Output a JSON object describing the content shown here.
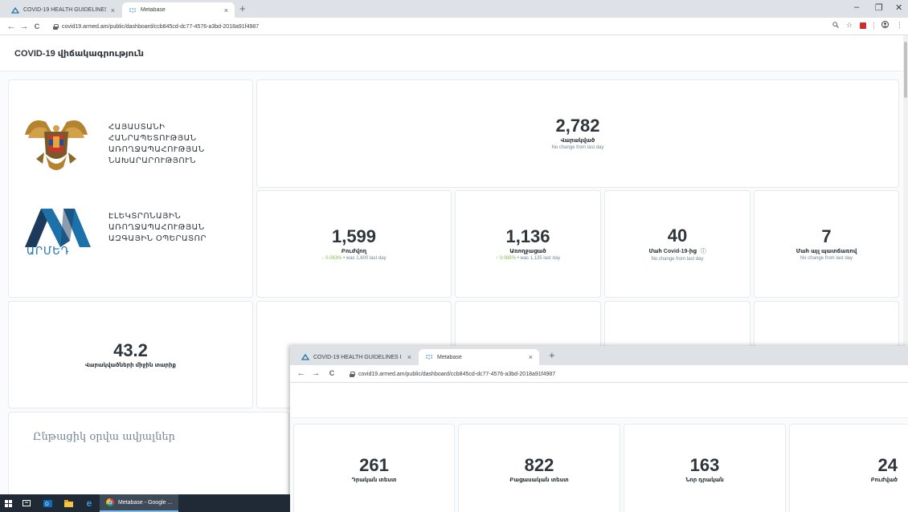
{
  "browser": {
    "tabs": [
      {
        "label": "COVID-19 HEALTH GUIDELINES I",
        "close": "×"
      },
      {
        "label": "Metabase",
        "close": "×"
      }
    ],
    "new_tab": "+",
    "window_controls": {
      "minimize": "–",
      "maximize": "❐",
      "close": "✕"
    },
    "nav": {
      "back": "←",
      "forward": "→",
      "reload": "C"
    },
    "url": "covid19.armed.am/public/dashboard/ccb845cd-dc77-4576-a3bd-2018a91f4987"
  },
  "dashboard": {
    "title": "COVID-19 վիճակագրություն",
    "gov_logo_lines": [
      "ՀԱՅԱՍՏԱՆԻ ՀԱՆՐԱՊԵՏՈՒԹՅԱՆ",
      "ԱՌՈՂՋԱՊԱՀՈՒԹՅԱՆ",
      "ՆԱԽԱՐԱՐՈՒԹՅՈՒՆ"
    ],
    "armed_logo_lines": [
      "ԷԼԵԿՏՐՈՆԱՅԻՆ",
      "ԱՌՈՂՋԱՊԱՀՈՒԹՅԱՆ",
      "ԱԶԳԱՅԻՆ ՕՊԵՐԱՏՈՐ"
    ],
    "armed_wordmark": "ԱՐՄԵԴ",
    "confirmed": {
      "value": "2,782",
      "label": "Վարակված",
      "sub": "No change from last day"
    },
    "recovering": {
      "value": "1,599",
      "label": "Բուժվող",
      "arrow": "↓",
      "change": "0.063%",
      "sub": " • was 1,600 last day"
    },
    "recovered": {
      "value": "1,136",
      "label": "Առողջացած",
      "arrow": "↑",
      "change": "0.088%",
      "sub": " • was 1,135 last day"
    },
    "deaths_covid": {
      "value": "40",
      "label": "Մահ Covid-19-ից",
      "info_icon": "ⓘ",
      "sub": "No change from last day"
    },
    "deaths_other": {
      "value": "7",
      "label": "Մահ այլ պատճառով",
      "sub": "No change from last day"
    },
    "avg_age": {
      "value": "43.2",
      "label": "Վարակվածների միջին տարիք"
    },
    "section_title": "Ընթացիկ օրվա ավյալներ"
  },
  "overlay": {
    "stats": [
      {
        "value": "261",
        "label": "Դրական տեստ"
      },
      {
        "value": "822",
        "label": "Բացասական տեստ"
      },
      {
        "value": "163",
        "label": "Նոր դրական"
      },
      {
        "value": "24",
        "label": "Բուժված"
      }
    ]
  },
  "taskbar": {
    "chrome_label": "Metabase - Google ..."
  },
  "colors": {
    "armed_blue": "#1c72a8",
    "armed_dark": "#1b3a5c",
    "positive": "#84bb4c",
    "metabase_blue": "#509ee3"
  }
}
